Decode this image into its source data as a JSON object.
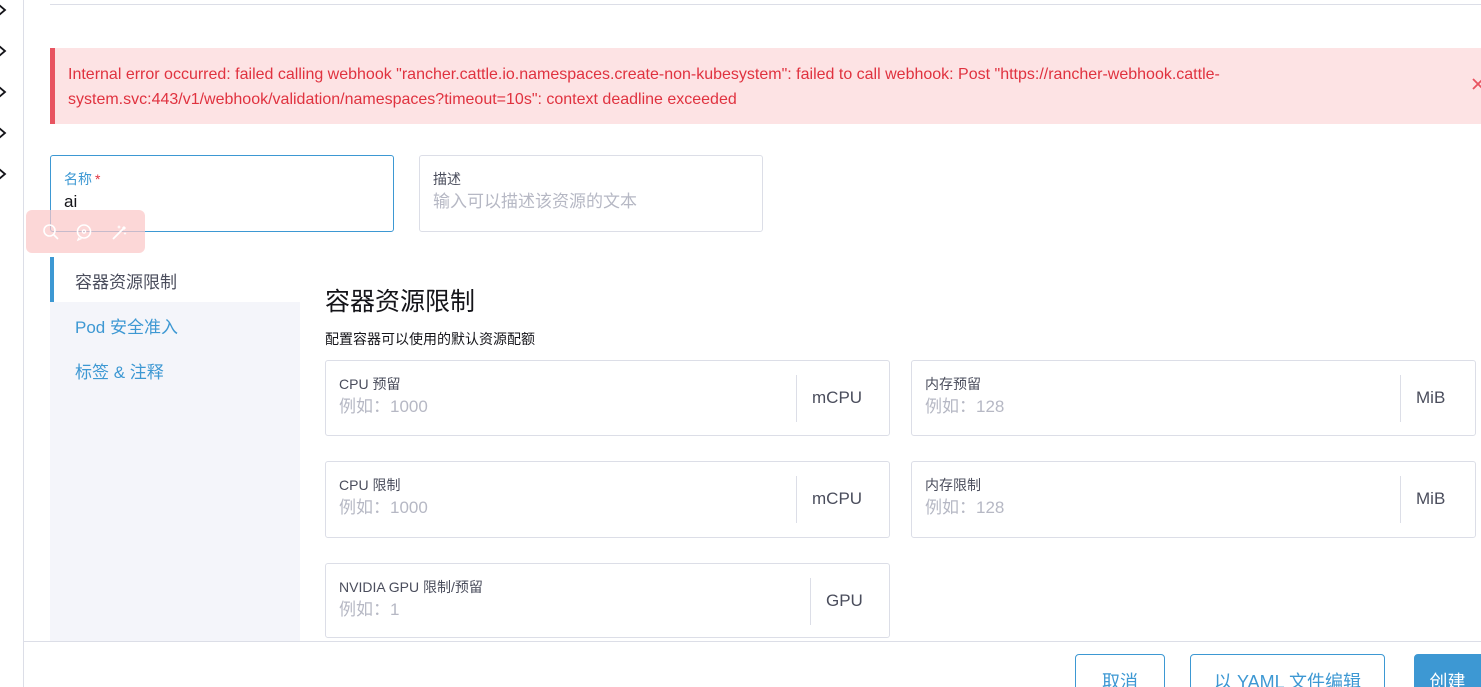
{
  "error": {
    "message": "Internal error occurred: failed calling webhook \"rancher.cattle.io.namespaces.create-non-kubesystem\": failed to call webhook: Post \"https://rancher-webhook.cattle-system.svc:443/v1/webhook/validation/namespaces?timeout=10s\": context deadline exceeded"
  },
  "form": {
    "name_label": "名称",
    "name_required_mark": "*",
    "name_value": "ai",
    "description_label": "描述",
    "description_placeholder": "输入可以描述该资源的文本"
  },
  "tabs": [
    {
      "label": "容器资源限制",
      "active": true
    },
    {
      "label": "Pod 安全准入",
      "active": false
    },
    {
      "label": "标签 & 注释",
      "active": false
    }
  ],
  "section": {
    "title": "容器资源限制",
    "description": "配置容器可以使用的默认资源配额"
  },
  "fields": {
    "cpu_reservation": {
      "label": "CPU 预留",
      "placeholder": "例如：1000",
      "suffix": "mCPU"
    },
    "memory_reservation": {
      "label": "内存预留",
      "placeholder": "例如：128",
      "suffix": "MiB"
    },
    "cpu_limit": {
      "label": "CPU 限制",
      "placeholder": "例如：1000",
      "suffix": "mCPU"
    },
    "memory_limit": {
      "label": "内存限制",
      "placeholder": "例如：128",
      "suffix": "MiB"
    },
    "gpu_limit": {
      "label": "NVIDIA GPU 限制/预留",
      "placeholder": "例如：1",
      "suffix": "GPU"
    }
  },
  "footer": {
    "cancel_label": "取消",
    "edit_yaml_label": "以 YAML 文件编辑",
    "create_label": "创建"
  },
  "icons": {
    "rail": "chevron-right-icon",
    "error_close": "close-icon",
    "toolbar": [
      "search-icon",
      "chat-icon",
      "magic-wand-icon"
    ]
  },
  "colors": {
    "accent": "#3d98d3",
    "error_text": "#e0323f",
    "error_background": "#fde3e4",
    "border": "#dcdee7",
    "tab_panel_background": "#f4f5fa"
  }
}
